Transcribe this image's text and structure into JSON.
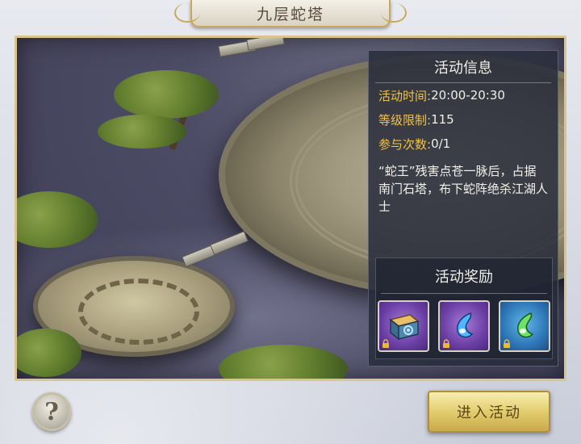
{
  "window": {
    "title": "九层蛇塔"
  },
  "info": {
    "header": "活动信息",
    "rows": [
      {
        "key": "活动时间:",
        "value": "20:00-20:30"
      },
      {
        "key": "等级限制:",
        "value": "115"
      },
      {
        "key": "参与次数:",
        "value": "0/1"
      }
    ],
    "description": "“蛇王”残害点苍一脉后，占据南门石塔，布下蛇阵绝杀江湖人士"
  },
  "rewards": {
    "header": "活动奖励",
    "items": [
      {
        "icon": "treasure-chest-icon",
        "rarity_color": "#6b3fa5",
        "locked": true
      },
      {
        "icon": "blue-spirit-gem-icon",
        "rarity_color": "#6b3fa5",
        "locked": true
      },
      {
        "icon": "green-spirit-gem-icon",
        "rarity_color": "#2e77b8",
        "locked": true
      }
    ]
  },
  "buttons": {
    "help_icon": "question-mark-icon",
    "enter_label": "进入活动"
  },
  "colors": {
    "accent_gold": "#f0c24a",
    "frame_gold": "#d8c48c",
    "enter_button": "#e2cd6e"
  }
}
